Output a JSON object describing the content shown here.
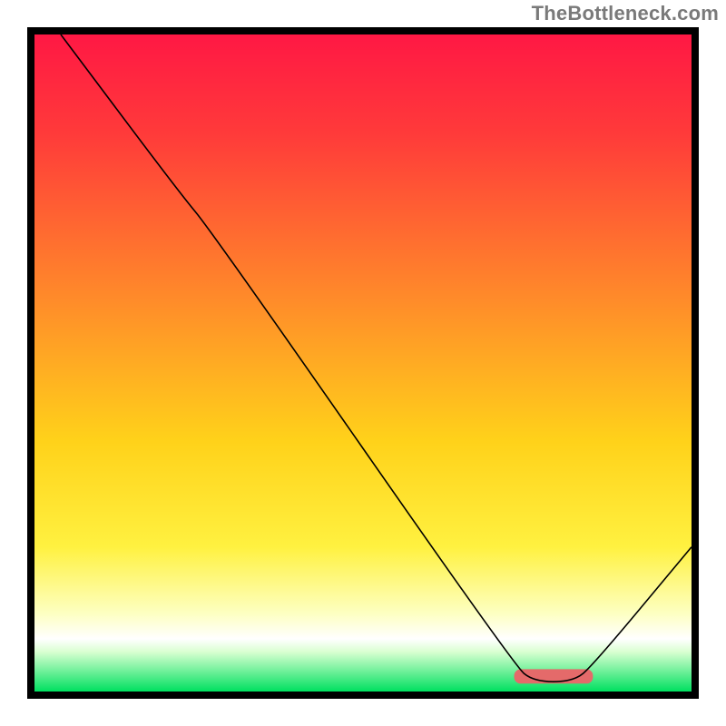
{
  "watermark": "TheBottleneck.com",
  "chart_data": {
    "type": "line",
    "title": "",
    "xlabel": "",
    "ylabel": "",
    "xlim": [
      0,
      100
    ],
    "ylim": [
      0,
      100
    ],
    "grid": false,
    "legend": false,
    "background_gradient": {
      "stops": [
        {
          "offset": 0,
          "color": "#ff1844"
        },
        {
          "offset": 15,
          "color": "#ff3a3a"
        },
        {
          "offset": 40,
          "color": "#ff8a2a"
        },
        {
          "offset": 62,
          "color": "#ffd21a"
        },
        {
          "offset": 78,
          "color": "#fff140"
        },
        {
          "offset": 88,
          "color": "#fdffc0"
        },
        {
          "offset": 92,
          "color": "#ffffff"
        },
        {
          "offset": 94,
          "color": "#d8ffd0"
        },
        {
          "offset": 100,
          "color": "#00e060"
        }
      ]
    },
    "series": [
      {
        "name": "bottleneck-curve",
        "stroke": "#000000",
        "stroke_width": 1.6,
        "points": [
          {
            "x": 4,
            "y": 100
          },
          {
            "x": 22,
            "y": 76
          },
          {
            "x": 27,
            "y": 70
          },
          {
            "x": 73,
            "y": 4
          },
          {
            "x": 76,
            "y": 1.5
          },
          {
            "x": 82,
            "y": 1.5
          },
          {
            "x": 85,
            "y": 4
          },
          {
            "x": 100,
            "y": 22
          }
        ]
      }
    ],
    "highlight_bar": {
      "color": "#e46a6a",
      "x_start": 73,
      "x_end": 85,
      "y": 1.2,
      "height": 2.2
    }
  }
}
